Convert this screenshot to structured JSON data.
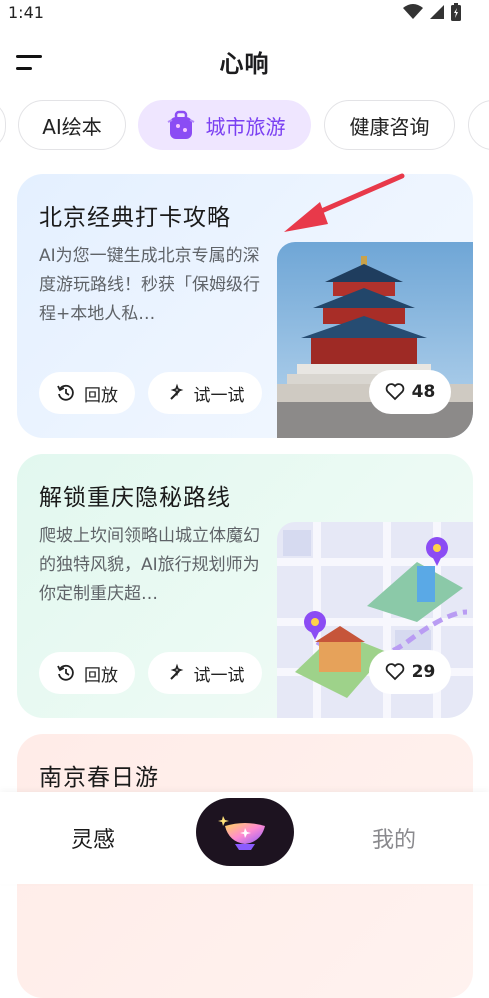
{
  "status": {
    "time": "1:41"
  },
  "header": {
    "title": "心响"
  },
  "tabs": [
    {
      "label": "AI绘本"
    },
    {
      "label": "城市旅游"
    },
    {
      "label": "健康咨询"
    }
  ],
  "cards": [
    {
      "title": "北京经典打卡攻略",
      "desc": "AI为您一键生成北京专属的深度游玩路线！秒获「保姆级行程+本地人私…",
      "replay": "回放",
      "try": "试一试",
      "likes": "48"
    },
    {
      "title": "解锁重庆隐秘路线",
      "desc": "爬坡上坎间领略山城立体魔幻的独特风貌，AI旅行规划师为你定制重庆超…",
      "replay": "回放",
      "try": "试一试",
      "likes": "29"
    },
    {
      "title": "南京春日游"
    }
  ],
  "nav": {
    "left": "灵感",
    "right": "我的"
  },
  "colors": {
    "accent": "#7a3ff2",
    "arrow": "#e8394a"
  }
}
